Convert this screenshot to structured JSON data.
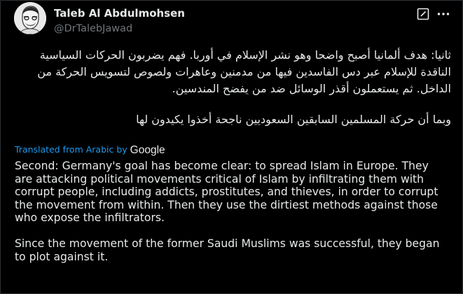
{
  "author": {
    "name": "Taleb Al Abdulmohsen",
    "handle": "@DrTalebJawad"
  },
  "icons": {
    "avatar": "profile-avatar",
    "edit": "edit-square-icon",
    "more": "more-dots-icon"
  },
  "original": {
    "paragraph1": "ثانيا: هدف ألمانيا أصبح واضحا وهو نشر الإسلام في أوربا. فهم يضربون الحركات السياسية الناقدة للإسلام عبر دس الفاسدين فيها من مدمنين وعاهرات ولصوص لتسويس الحركة من الداخل. ثم يستعملون أقذر الوسائل ضد من يفضح المندسين.",
    "paragraph2": "وبما أن حركة المسلمين السابقين السعوديين ناجحة أخذوا يكيدون لها"
  },
  "translation": {
    "label": "Translated from Arabic by",
    "provider": "Google",
    "paragraph1": "Second: Germany's goal has become clear: to spread Islam in Europe. They are attacking political movements critical of Islam by infiltrating them with corrupt people, including addicts, prostitutes, and thieves, in order to corrupt the movement from within. Then they use the dirtiest methods against those who expose the infiltrators.",
    "paragraph2": "Since the movement of the former Saudi Muslims was successful, they began to plot against it."
  },
  "colors": {
    "background": "#000000",
    "text": "#e7e9ea",
    "muted": "#71767b",
    "link": "#1d9bf0",
    "border": "#2f3336"
  }
}
